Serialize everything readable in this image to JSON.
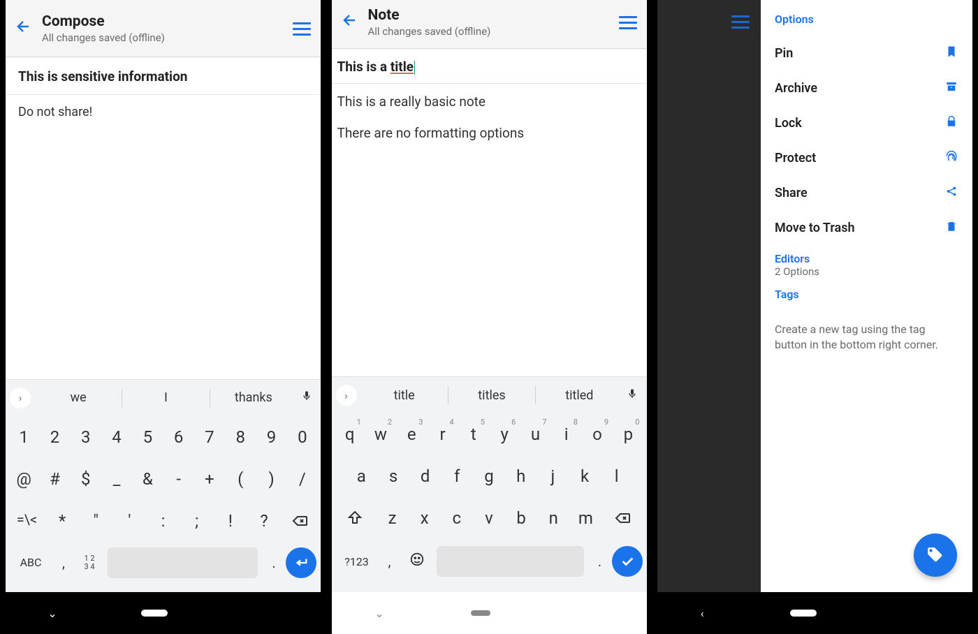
{
  "s1": {
    "header_title": "Compose",
    "header_sub": "All changes saved (offline)",
    "note_title": "This is sensitive information",
    "body": "Do not share!",
    "suggestions": [
      "we",
      "I",
      "thanks"
    ],
    "row1": [
      "1",
      "2",
      "3",
      "4",
      "5",
      "6",
      "7",
      "8",
      "9",
      "0"
    ],
    "row2": [
      "@",
      "#",
      "$",
      "_",
      "&",
      "-",
      "+",
      "(",
      ")",
      "/"
    ],
    "row3": [
      "=\\<",
      "*",
      "\"",
      "'",
      ":",
      ";",
      "!",
      "?"
    ],
    "sym_label": "ABC",
    "smallnums_top": "1 2",
    "smallnums_bot": "3 4",
    "comma": ",",
    "dot": "."
  },
  "s2": {
    "header_title": "Note",
    "header_sub": "All changes saved (offline)",
    "title_pre": "This is a ",
    "title_u": "title",
    "body_l1": "This is a really basic note",
    "body_l2": "There are no formatting options",
    "suggestions": [
      "title",
      "titles",
      "titled"
    ],
    "row1": [
      {
        "k": "q",
        "s": "1"
      },
      {
        "k": "w",
        "s": "2"
      },
      {
        "k": "e",
        "s": "3"
      },
      {
        "k": "r",
        "s": "4"
      },
      {
        "k": "t",
        "s": "5"
      },
      {
        "k": "y",
        "s": "6"
      },
      {
        "k": "u",
        "s": "7"
      },
      {
        "k": "i",
        "s": "8"
      },
      {
        "k": "o",
        "s": "9"
      },
      {
        "k": "p",
        "s": "0"
      }
    ],
    "row2": [
      "a",
      "s",
      "d",
      "f",
      "g",
      "h",
      "j",
      "k",
      "l"
    ],
    "row3": [
      "z",
      "x",
      "c",
      "v",
      "b",
      "n",
      "m"
    ],
    "sym_label": "?123",
    "comma": ",",
    "dot": "."
  },
  "s3": {
    "section_options": "Options",
    "items": [
      {
        "label": "Pin",
        "icon": "bookmark"
      },
      {
        "label": "Archive",
        "icon": "archive"
      },
      {
        "label": "Lock",
        "icon": "lock"
      },
      {
        "label": "Protect",
        "icon": "fingerprint"
      },
      {
        "label": "Share",
        "icon": "share"
      },
      {
        "label": "Move to Trash",
        "icon": "trash"
      }
    ],
    "section_editors": "Editors",
    "editors_sub": "2 Options",
    "section_tags": "Tags",
    "tag_hint": "Create a new tag using the tag button in the bottom right corner."
  }
}
